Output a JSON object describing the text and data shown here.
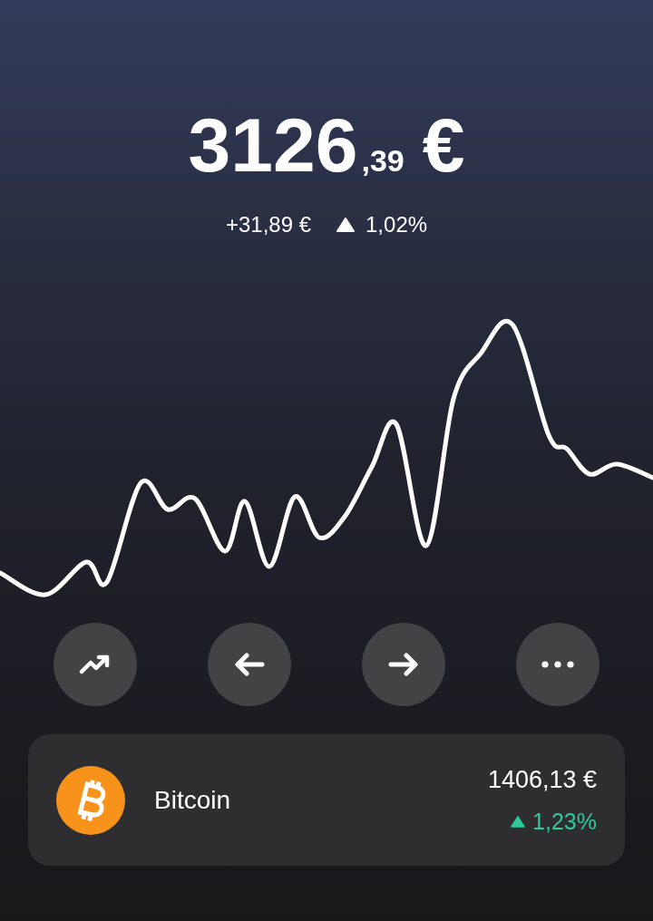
{
  "balance": {
    "whole": "3126",
    "fraction": ",39",
    "currency": "€"
  },
  "change": {
    "amount": "+31,89 €",
    "rising": true,
    "percent": "1,02%"
  },
  "chart": {
    "kind": "sparkline"
  },
  "actions": [
    {
      "kind": "trend"
    },
    {
      "kind": "receive"
    },
    {
      "kind": "send"
    },
    {
      "kind": "more"
    }
  ],
  "assets": [
    {
      "kind": "bitcoin",
      "name": "Bitcoin",
      "value": "1406,13 €",
      "rising": true,
      "change": "1,23%"
    }
  ]
}
